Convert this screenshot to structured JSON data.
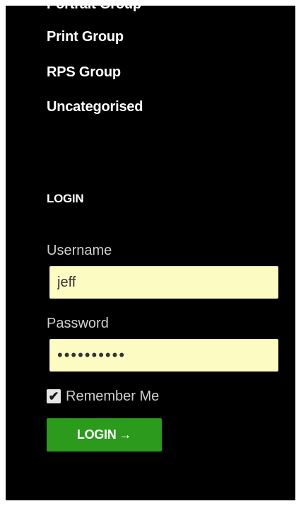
{
  "categories": {
    "items": [
      {
        "label": "Portrait Group"
      },
      {
        "label": "Print Group"
      },
      {
        "label": "RPS Group"
      },
      {
        "label": "Uncategorised"
      }
    ]
  },
  "login": {
    "title": "LOGIN",
    "username_label": "Username",
    "username_value": "jeff",
    "password_label": "Password",
    "password_value": "0123456789",
    "remember_label": "Remember Me",
    "remember_checked": true,
    "checkbox_glyph": "✔",
    "button_label": "LOGIN",
    "button_arrow": "→"
  },
  "colors": {
    "background": "#000000",
    "input_background": "#fbfbc2",
    "button": "#2b9a1d"
  }
}
